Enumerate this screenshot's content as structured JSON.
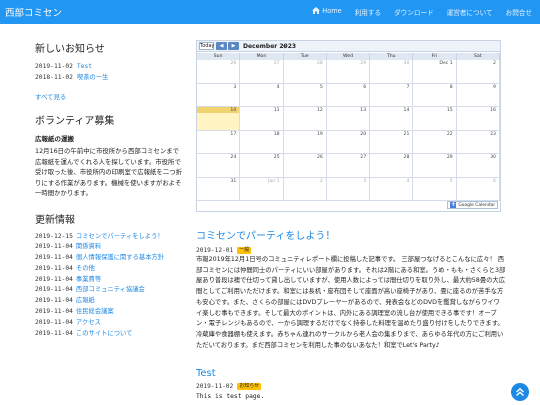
{
  "header": {
    "title": "西部コミセン",
    "nav": [
      {
        "label": "Home",
        "icon": "home-icon"
      },
      {
        "label": "利用する"
      },
      {
        "label": "ダウンロード"
      },
      {
        "label": "運営者について"
      },
      {
        "label": "お問合せ"
      }
    ]
  },
  "news": {
    "heading": "新しいお知らせ",
    "items": [
      {
        "date": "2019-11-02",
        "title": "Test"
      },
      {
        "date": "2018-11-02",
        "title": "喫茶の一生"
      }
    ],
    "see_all": "すべて見る"
  },
  "volunteer": {
    "heading": "ボランティア募集",
    "title": "広報紙の運搬",
    "body": "12月16日の午前中に市役所から西部コミセンまで広報紙を運んでくれる人を探しています。市役所で受け取った後、市役所内の印刷室で広報紙を二つ折りにする作業があります。機械を使いますがおよそ一時間かかります。"
  },
  "updates": {
    "heading": "更新情報",
    "items": [
      {
        "date": "2019-12-15",
        "title": "コミセンでパーティをしよう！"
      },
      {
        "date": "2019-11-04",
        "title": "関係資料"
      },
      {
        "date": "2019-11-04",
        "title": "個人情報保護に関する基本方針"
      },
      {
        "date": "2019-11-04",
        "title": "その他"
      },
      {
        "date": "2019-11-04",
        "title": "事業費等"
      },
      {
        "date": "2019-11-04",
        "title": "西部コミュニティ協議会"
      },
      {
        "date": "2019-11-04",
        "title": "広報紙"
      },
      {
        "date": "2019-11-04",
        "title": "住民総会議案"
      },
      {
        "date": "2019-11-04",
        "title": "アクセス"
      },
      {
        "date": "2019-11-04",
        "title": "このサイトについて"
      }
    ]
  },
  "calendar": {
    "today_label": "Today",
    "prev_icon": "chevron-left-icon",
    "next_icon": "chevron-right-icon",
    "month_label": "December 2023",
    "weekdays": [
      "Sun",
      "Mon",
      "Tue",
      "Wed",
      "Thu",
      "Fri",
      "Sat"
    ],
    "weeks": [
      [
        "26",
        "27",
        "28",
        "29",
        "30",
        "Dec 1",
        "2"
      ],
      [
        "3",
        "4",
        "5",
        "6",
        "7",
        "8",
        "9"
      ],
      [
        "10",
        "11",
        "12",
        "13",
        "14",
        "15",
        "16"
      ],
      [
        "17",
        "18",
        "19",
        "20",
        "21",
        "22",
        "23"
      ],
      [
        "24",
        "25",
        "26",
        "27",
        "28",
        "29",
        "30"
      ],
      [
        "31",
        "Jan 1",
        "2",
        "3",
        "4",
        "5",
        "6"
      ]
    ],
    "footer_label": "Google Calendar"
  },
  "posts": [
    {
      "title": "コミセンでパーティをしよう！",
      "date": "2019-12-01",
      "badge": "一般",
      "body": "市報2019年12月1日号のコミュニティレポート欄に投稿した記事です。 三部屋つなげるとこんなに広々！ 西部コミセンには仲間同士のパーティにいい部屋があります。それは2階にある和室。うめ・もも・さくらと3部屋あり普段は襖で仕切って貸し出していますが、使用人数によっては間仕切りを取り外し、最大約58畳の大広間としてご利用いただけます。和室には長机・座布団そして座面が高い座椅子があり、畳に座るのが苦手な方も安心です。また、さくらの部屋にはDVDプレーヤーがあるので、発表会などのDVDを鑑賞しながらワイワイ楽しむ事もできます。そして最大のポイントは、内外にある調理室の流し台が使用できる事です！オーブン・電子レンジもあるので、一から調理するだけでなく持参した料理を温めたり盛り付けをしたりできます。冷蔵庫や食器棚も使えます。赤ちゃん連れのサークルから老人会の集まりまで、あらゆる年代の方にご利用いただいております。まだ西部コミセンを利用した事のないあなた！和室でLet's Party♪"
    },
    {
      "title": "Test",
      "date": "2019-11-02",
      "badge": "お知らせ",
      "body": "This is test page."
    }
  ],
  "colors": {
    "accent": "#2196f3",
    "link": "#1e88e5",
    "badge": "#ffc107",
    "today_cell": "#fff4c2"
  },
  "scroll_top_icon": "double-chevron-up-icon"
}
